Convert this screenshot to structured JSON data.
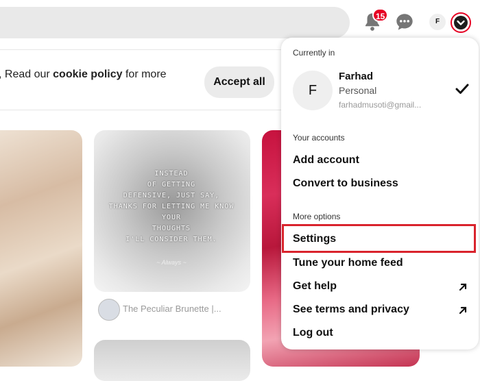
{
  "header": {
    "notification_count": "15",
    "user_initial": "F"
  },
  "cookie_banner": {
    "text_before": ", Read our ",
    "link": "cookie policy",
    "text_after": " for more",
    "accept_label": "Accept all"
  },
  "pins": {
    "quote_lines": [
      "INSTEAD",
      "OF GETTING",
      "DEFENSIVE, JUST SAY,",
      "THANKS FOR LETTING ME KNOW",
      "YOUR",
      "THOUGHTS",
      "I'LL CONSIDER THEM."
    ],
    "quote_signature": "~ Always ~",
    "author": "The Peculiar Brunette |..."
  },
  "menu": {
    "currently_in": "Currently in",
    "account": {
      "initial": "F",
      "name": "Farhad",
      "type": "Personal",
      "email": "farhadmusoti@gmail..."
    },
    "your_accounts_title": "Your accounts",
    "add_account": "Add account",
    "convert_business": "Convert to business",
    "more_options_title": "More options",
    "settings": "Settings",
    "tune_feed": "Tune your home feed",
    "get_help": "Get help",
    "terms": "See terms and privacy",
    "logout": "Log out"
  },
  "colors": {
    "brand_red": "#e60023",
    "highlight_red": "#d9232c"
  }
}
